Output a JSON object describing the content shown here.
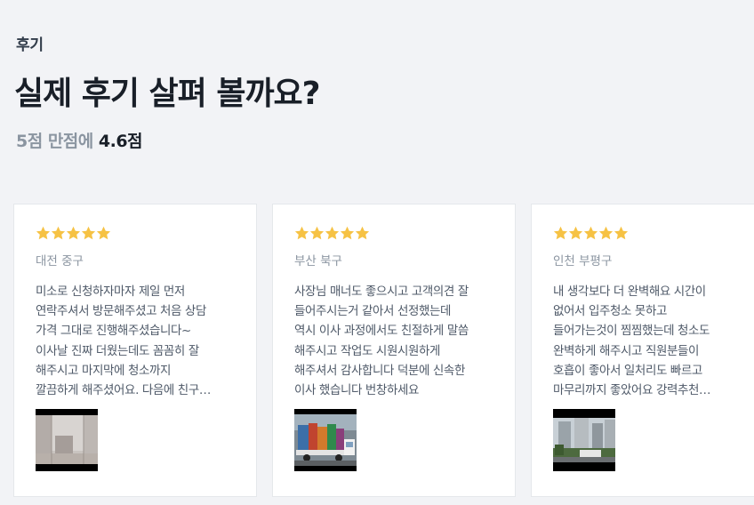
{
  "section": {
    "label": "후기",
    "title": "실제 후기 살펴 볼까요?",
    "score_prefix": "5점 만점에 ",
    "score_value": "4.6점"
  },
  "colors": {
    "star": "#f6c244",
    "title": "#191f28",
    "muted": "#8b95a1",
    "body_text": "#4e5968",
    "background": "#f2f3f6"
  },
  "reviews": [
    {
      "rating": 5,
      "location": "대전 중구",
      "lines": [
        "미소로 신청하자마자 제일 먼저",
        "연락주셔서 방문해주셨고 처음 상담",
        "가격 그대로 진행해주셨습니다~",
        "이사날 진짜 더웠는데도 꼼꼼히 잘",
        "해주시고 마지막에 청소까지",
        "깔끔하게 해주셨어요. 다음에 친구…"
      ],
      "photo": "room-photo"
    },
    {
      "rating": 5,
      "location": "부산 북구",
      "lines": [
        "사장님 매너도 좋으시고 고객의견 잘",
        "들어주시는거 같아서 선정했는데",
        "역시 이사 과정에서도 친절하게 말씀",
        "해주시고 작업도 시원시원하게",
        "해주셔서 감사합니다 덕분에 신속한",
        "이사 했습니다 번창하세요"
      ],
      "photo": "truck-photo"
    },
    {
      "rating": 5,
      "location": "인천 부평구",
      "lines": [
        "내 생각보다 더 완벽해요 시간이",
        "없어서 입주청소 못하고",
        "들어가는것이 찜찜했는데 청소도",
        "완벽하게 해주시고 직원분들이",
        "호흡이 좋아서 일처리도 빠르고",
        "마무리까지 좋았어요 강력추천…"
      ],
      "photo": "apartment-photo"
    }
  ]
}
